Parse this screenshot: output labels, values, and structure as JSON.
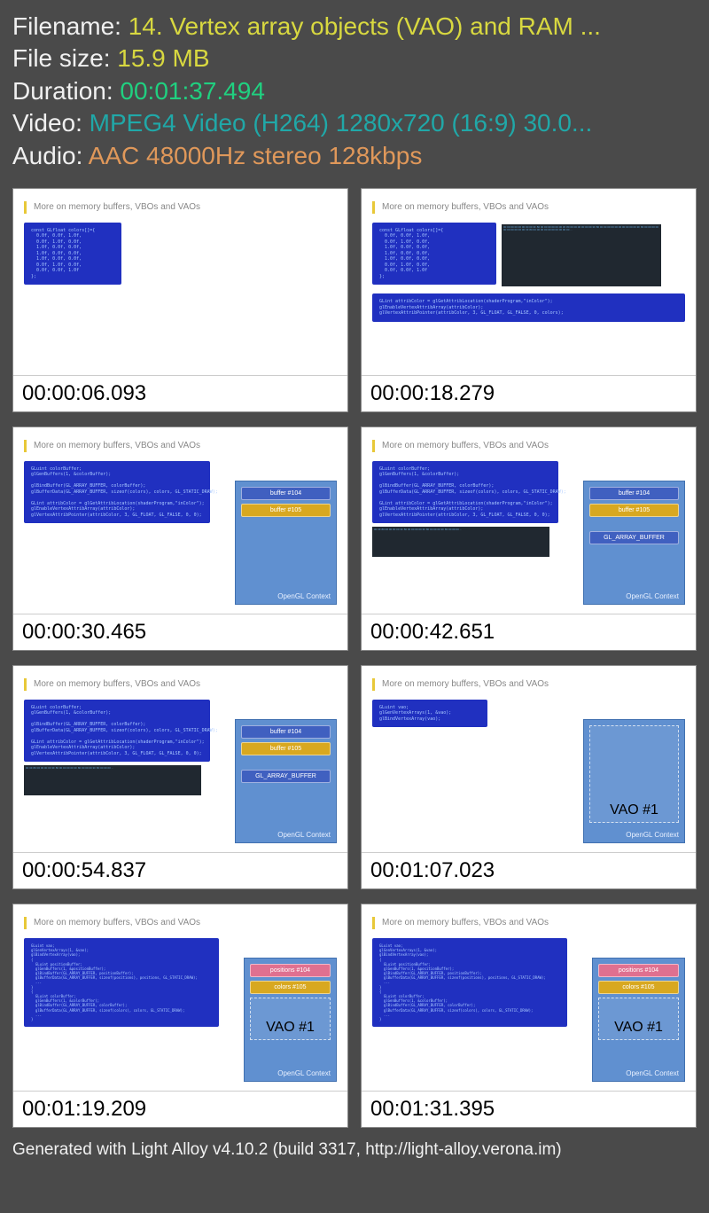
{
  "info": {
    "filename_label": "Filename: ",
    "filename_value": "14. Vertex array objects (VAO) and RAM ...",
    "filesize_label": "File size: ",
    "filesize_value": "15.9 MB",
    "duration_label": "Duration: ",
    "duration_value": "00:01:37.494",
    "video_label": "Video: ",
    "video_value": "MPEG4 Video (H264) 1280x720 (16:9) 30.0...",
    "audio_label": "Audio: ",
    "audio_value": "AAC 48000Hz stereo 128kbps"
  },
  "slide_title": "More on memory buffers, VBOs and VAOs",
  "context_label": "OpenGL Context",
  "labels": {
    "buffer104": "buffer #104",
    "buffer105": "buffer #105",
    "gl_array_buffer": "GL_ARRAY_BUFFER",
    "positions104": "positions #104",
    "colors105": "colors #105",
    "vao1": "VAO #1"
  },
  "code": {
    "colors_array": "const GLfloat colors[]={\n  0.0f, 0.0f, 1.0f,\n  0.0f, 1.0f, 0.0f,\n  1.0f, 0.0f, 0.0f,\n  1.0f, 0.0f, 0.0f,\n  1.0f, 0.0f, 0.0f,\n  0.0f, 1.0f, 0.0f,\n  0.0f, 0.0f, 1.0f\n};",
    "attrib_block": "GLint attribColor = glGetAttribLocation(shaderProgram,\"inColor\");\nglEnableVertexAttribArray(attribColor);\nglVertexAttribPointer(attribColor, 3, GL_FLOAT, GL_FALSE, 0, colors);",
    "buffer_block": "GLuint colorBuffer;\nglGenBuffers(1, &colorBuffer);\n\nglBindBuffer(GL_ARRAY_BUFFER, colorBuffer);\nglBufferData(GL_ARRAY_BUFFER, sizeof(colors), colors, GL_STATIC_DRAW);\n\nGLint attribColor = glGetAttribLocation(shaderProgram,\"inColor\");\nglEnableVertexAttribArray(attribColor);\nglVertexAttribPointer(attribColor, 3, GL_FLOAT, GL_FALSE, 0, 0);",
    "vao_small": "GLuint vao;\nglGenVertexArrays(1, &vao);\nglBindVertexArray(vao);",
    "vao_full": "GLuint vao;\nglGenVertexArrays(1, &vao);\nglBindVertexArray(vao);\n{\n  GLuint positionBuffer;\n  glGenBuffers(1, &positionBuffer);\n  glBindBuffer(GL_ARRAY_BUFFER, positionBuffer);\n  glBufferData(GL_ARRAY_BUFFER, sizeof(positions), positions, GL_STATIC_DRAW);\n  ...\n}\n{\n  GLuint colorBuffer;\n  glGenBuffers(1, &colorBuffer);\n  glBindBuffer(GL_ARRAY_BUFFER, colorBuffer);\n  glBufferData(GL_ARRAY_BUFFER, sizeof(colors), colors, GL_STATIC_DRAW);\n  ...\n}"
  },
  "thumbnails": [
    {
      "timestamp": "00:00:06.093"
    },
    {
      "timestamp": "00:00:18.279"
    },
    {
      "timestamp": "00:00:30.465"
    },
    {
      "timestamp": "00:00:42.651"
    },
    {
      "timestamp": "00:00:54.837"
    },
    {
      "timestamp": "00:01:07.023"
    },
    {
      "timestamp": "00:01:19.209"
    },
    {
      "timestamp": "00:01:31.395"
    }
  ],
  "footer": "Generated with Light Alloy v4.10.2 (build 3317, http://light-alloy.verona.im)"
}
